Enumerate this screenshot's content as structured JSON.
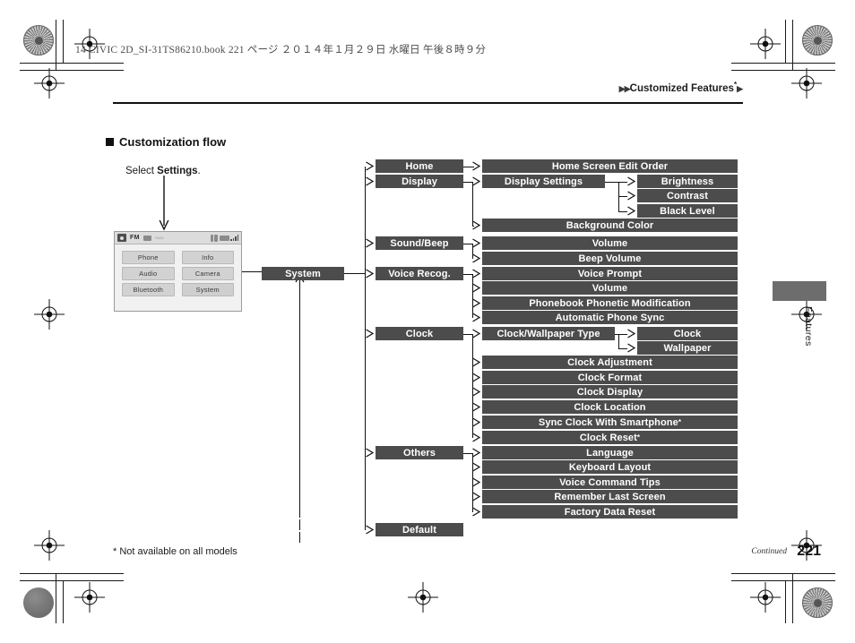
{
  "header": {
    "slug": "14 CIVIC 2D_SI-31TS86210.book   221 ページ   ２０１４年１月２９日   水曜日   午後８時９分",
    "running_head": "Customized Features",
    "running_head_marker_left": "▶▶",
    "running_head_marker_right": "▶",
    "running_head_sup": "*"
  },
  "section": {
    "title": "Customization flow",
    "select_note_prefix": "Select ",
    "select_note_bold": "Settings",
    "select_note_suffix": "."
  },
  "device_screen": {
    "source_label": "FM",
    "faint_label": "Auto",
    "tiles": [
      {
        "label": "Phone"
      },
      {
        "label": "Info"
      },
      {
        "label": "Audio"
      },
      {
        "label": "Camera"
      },
      {
        "label": "Bluetooth"
      },
      {
        "label": "System"
      }
    ]
  },
  "flow": {
    "root": {
      "label": "System"
    },
    "level2": [
      {
        "label": "Home"
      },
      {
        "label": "Display"
      },
      {
        "label": "Sound/Beep"
      },
      {
        "label": "Voice Recog."
      },
      {
        "label": "Clock"
      },
      {
        "label": "Others"
      },
      {
        "label": "Default"
      }
    ],
    "level3": [
      {
        "label": "Home Screen Edit Order"
      },
      {
        "label": "Display Settings"
      },
      {
        "label": "Background Color"
      },
      {
        "label": "Volume"
      },
      {
        "label": "Beep Volume"
      },
      {
        "label": "Voice Prompt"
      },
      {
        "label": "Volume"
      },
      {
        "label": "Phonebook Phonetic Modification"
      },
      {
        "label": "Automatic Phone Sync"
      },
      {
        "label": "Clock/Wallpaper Type"
      },
      {
        "label": "Clock Adjustment"
      },
      {
        "label": "Clock Format"
      },
      {
        "label": "Clock Display"
      },
      {
        "label": "Clock Location"
      },
      {
        "label": "Sync Clock With Smartphone",
        "sup": "*"
      },
      {
        "label": "Clock Reset",
        "sup": "*"
      },
      {
        "label": "Language"
      },
      {
        "label": "Keyboard Layout"
      },
      {
        "label": "Voice Command Tips"
      },
      {
        "label": "Remember Last Screen"
      },
      {
        "label": "Factory Data Reset"
      }
    ],
    "level4": [
      {
        "label": "Brightness"
      },
      {
        "label": "Contrast"
      },
      {
        "label": "Black Level"
      },
      {
        "label": "Clock"
      },
      {
        "label": "Wallpaper"
      }
    ]
  },
  "sidebar": {
    "tab_label": "Features"
  },
  "footer": {
    "footnote": "* Not available on all models",
    "continued": "Continued",
    "page_number": "221"
  },
  "colors": {
    "box_fill": "#4c4c4c",
    "box_text": "#ffffff",
    "tab_fill": "#6d6d6d",
    "rule": "#111111"
  }
}
